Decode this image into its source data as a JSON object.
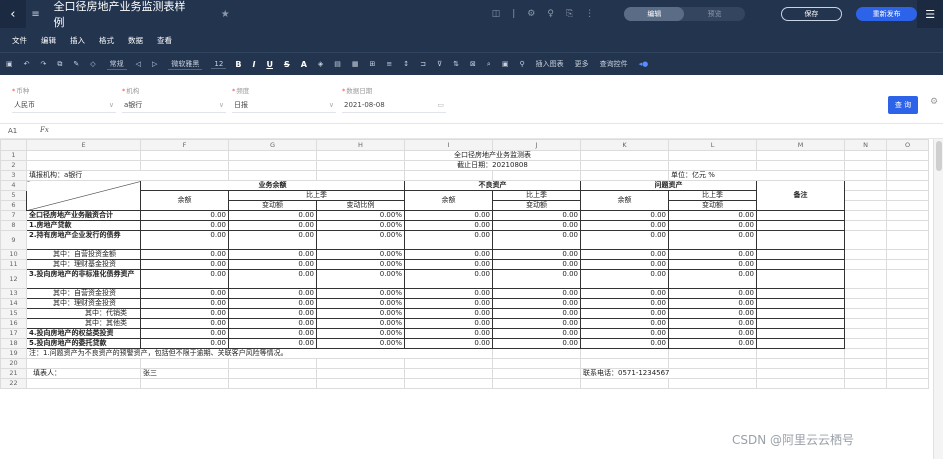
{
  "toolbar_top": {
    "title": "全口径房地产业务监测表样例",
    "mode_edit": "编辑",
    "mode_preview": "预览",
    "save": "保存",
    "publish": "重新发布"
  },
  "menu": [
    "文件",
    "编辑",
    "插入",
    "格式",
    "数据",
    "查看"
  ],
  "format_bar": {
    "number_format": "常规",
    "font": "微软雅黑",
    "size": "12",
    "insert_chart": "插入图表",
    "more": "更多",
    "query_control": "查询控件"
  },
  "filters": {
    "currency": {
      "label": "币种",
      "value": "人民币"
    },
    "org": {
      "label": "机构",
      "value": "a银行"
    },
    "freq": {
      "label": "频度",
      "value": "日报"
    },
    "date": {
      "label": "数据日期",
      "value": "2021-08-08"
    },
    "query_button": "查 询"
  },
  "formula_bar": {
    "cell": "A1",
    "fx": "Fx"
  },
  "columns": [
    "E",
    "F",
    "G",
    "H",
    "I",
    "J",
    "K",
    "L",
    "M",
    "N",
    "O"
  ],
  "sheet": {
    "title": "全口径房地产业务监测表",
    "date_line": "截止日期：20210808",
    "org_line": "填报机构：a银行",
    "unit_line": "单位：亿元 %",
    "h_business": "业务余额",
    "h_bad": "不良资产",
    "h_problem": "问题资产",
    "h_remark": "备注",
    "h_balance": "余额",
    "h_vs_last": "比上季",
    "h_change": "变动额",
    "h_ratio": "变动比例",
    "rows": [
      {
        "label": "全口径房地产业务融资合计",
        "bold": true,
        "indent": 0
      },
      {
        "label": "1.房地产贷款",
        "bold": true,
        "indent": 0
      },
      {
        "label": "2.持有房地产企业发行的债券",
        "bold": true,
        "indent": 0
      },
      {
        "label": "其中：自营投资金额",
        "bold": false,
        "indent": 1
      },
      {
        "label": "其中：理财基金投资",
        "bold": false,
        "indent": 1
      },
      {
        "label": "3.投向房地产的非标准化债券资产",
        "bold": true,
        "indent": 0
      },
      {
        "label": "其中：自营资金投资",
        "bold": false,
        "indent": 1
      },
      {
        "label": "其中：理财资金投资",
        "bold": false,
        "indent": 1
      },
      {
        "label": "其中：代销类",
        "bold": false,
        "indent": 2
      },
      {
        "label": "其中：其他类",
        "bold": false,
        "indent": 2
      },
      {
        "label": "4.投向房地产的权益类投资",
        "bold": true,
        "indent": 0
      },
      {
        "label": "5.投向房地产的委托贷款",
        "bold": true,
        "indent": 0
      }
    ],
    "zero": "0.00",
    "zero_pct": "0.00%",
    "note": "注：1.问题资产为不良资产的预警资产，包括但不限于逾期、关联客户风险等情况。",
    "filler_label": "填表人：",
    "filler_value": "张三",
    "contact": "联系电话：0571-1234567"
  },
  "watermark": "CSDN @阿里云云栖号"
}
